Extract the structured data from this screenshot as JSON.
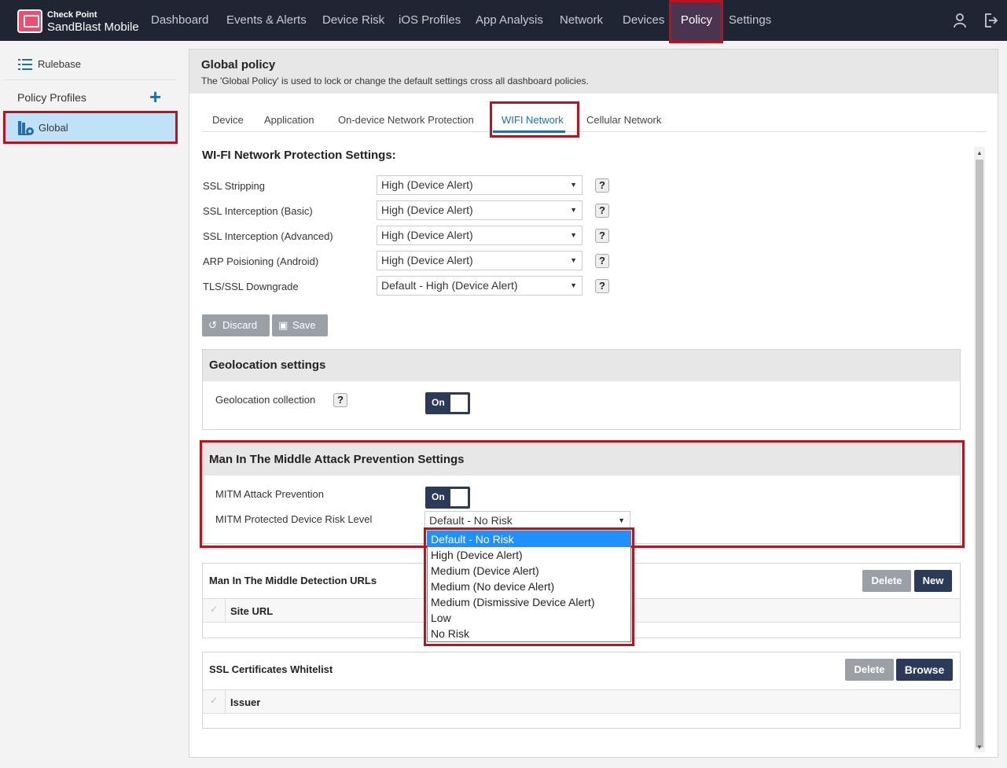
{
  "brand": {
    "top": "Check Point",
    "bottom": "SandBlast Mobile"
  },
  "nav": [
    "Dashboard",
    "Events & Alerts",
    "Device Risk",
    "iOS Profiles",
    "App Analysis",
    "Network",
    "Devices",
    "Policy",
    "Settings"
  ],
  "sidebar": {
    "rulebase": "Rulebase",
    "profiles": "Policy Profiles",
    "add": "+",
    "global": "Global"
  },
  "main": {
    "title": "Global policy",
    "description": "The 'Global Policy' is used to lock or change the default settings cross all dashboard policies."
  },
  "tabs": [
    "Device",
    "Application",
    "On-device Network Protection",
    "WIFI Network",
    "Cellular Network"
  ],
  "wifi": {
    "title": "WI-FI Network Protection Settings:",
    "rows": [
      {
        "label": "SSL Stripping",
        "value": "High (Device Alert)"
      },
      {
        "label": "SSL Interception (Basic)",
        "value": "High (Device Alert)"
      },
      {
        "label": "SSL Interception (Advanced)",
        "value": "High (Device Alert)"
      },
      {
        "label": "ARP Poisioning (Android)",
        "value": "High (Device Alert)"
      },
      {
        "label": "TLS/SSL Downgrade",
        "value": "Default - High (Device Alert)"
      }
    ],
    "help": "?",
    "discard": "Discard",
    "save": "Save"
  },
  "geo": {
    "title": "Geolocation settings",
    "label": "Geolocation collection",
    "toggle": "On"
  },
  "mitm": {
    "title": "Man In The Middle Attack Prevention Settings",
    "prevention_label": "MITM Attack Prevention",
    "toggle": "On",
    "risk_label": "MITM Protected Device Risk Level",
    "risk_value": "Default - No Risk",
    "options": [
      "Default - No Risk",
      "High (Device Alert)",
      "Medium (Device Alert)",
      "Medium (No device Alert)",
      "Medium (Dismissive Device Alert)",
      "Low",
      "No Risk"
    ]
  },
  "urls": {
    "title": "Man In The Middle Detection URLs",
    "delete": "Delete",
    "new": "New",
    "col": "Site URL"
  },
  "certs": {
    "title": "SSL Certificates Whitelist",
    "delete": "Delete",
    "browse": "Browse",
    "col": "Issuer"
  },
  "colors": {
    "nav_bg": "#1f2533",
    "accent": "#1e6fb5",
    "highlight": "#c0101a",
    "toggle": "#2c3a5a"
  }
}
